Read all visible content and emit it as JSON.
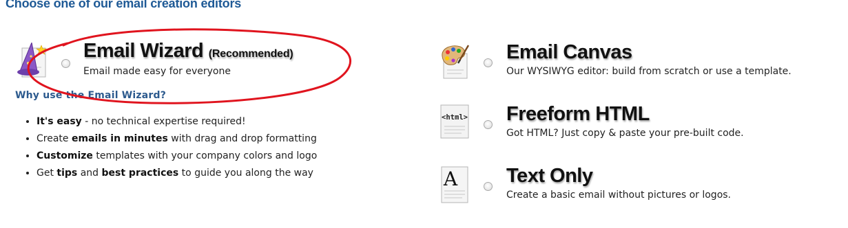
{
  "heading": "Choose one of our email creation editors",
  "options": [
    {
      "id": "email-wizard",
      "title": "Email Wizard",
      "badge": "(Recommended)",
      "description": "Email made easy for everyone",
      "icon": "wizard-hat-document-icon",
      "selected": false
    },
    {
      "id": "email-canvas",
      "title": "Email Canvas",
      "description": "Our WYSIWYG editor: build from scratch or use a template.",
      "icon": "paint-palette-document-icon",
      "selected": false
    },
    {
      "id": "freeform-html",
      "title": "Freeform HTML",
      "description": "Got HTML?  Just copy & paste your pre-built code.",
      "icon": "html-tag-document-icon",
      "selected": false
    },
    {
      "id": "text-only",
      "title": "Text Only",
      "description": "Create a basic email without pictures or logos.",
      "icon": "letter-a-document-icon",
      "selected": false
    }
  ],
  "why": {
    "label": "Why use the Email Wizard?",
    "items": [
      {
        "parts": [
          {
            "text": "It's easy",
            "bold": true
          },
          {
            "text": " - no technical expertise required!",
            "bold": false
          }
        ]
      },
      {
        "parts": [
          {
            "text": "Create ",
            "bold": false
          },
          {
            "text": "emails in minutes",
            "bold": true
          },
          {
            "text": " with drag and drop formatting",
            "bold": false
          }
        ]
      },
      {
        "parts": [
          {
            "text": "Customize",
            "bold": true
          },
          {
            "text": " templates with your company colors and logo",
            "bold": false
          }
        ]
      },
      {
        "parts": [
          {
            "text": "Get ",
            "bold": false
          },
          {
            "text": "tips",
            "bold": true
          },
          {
            "text": " and ",
            "bold": false
          },
          {
            "text": "best practices",
            "bold": true
          },
          {
            "text": " to guide you along the way",
            "bold": false
          }
        ]
      }
    ]
  },
  "icon_texts": {
    "html_tag": "<html>",
    "letter": "A"
  },
  "annotation": {
    "color": "#e0141e"
  }
}
